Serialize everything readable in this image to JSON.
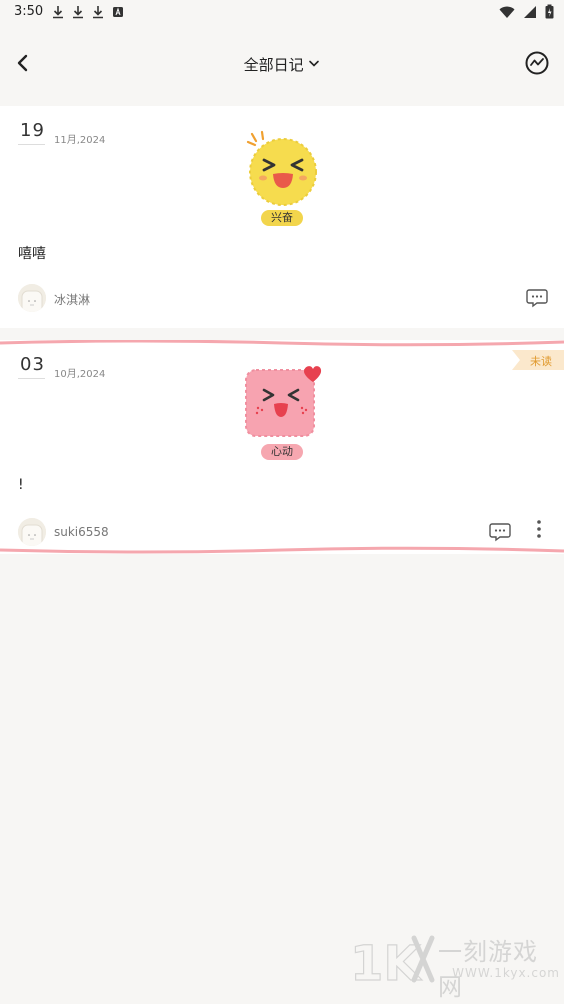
{
  "status_bar": {
    "time": "3:50"
  },
  "header": {
    "title": "全部日记"
  },
  "entries": [
    {
      "day": "19",
      "month_year": "11月,2024",
      "mood_label": "兴奋",
      "content": "嘻嘻",
      "author": "冰淇淋"
    },
    {
      "day": "03",
      "month_year": "10月,2024",
      "mood_label": "心动",
      "content": "!",
      "author": "suki6558",
      "badge": "未读"
    }
  ],
  "watermark": {
    "brand": "一刻游戏网",
    "url": "WWW.1kyx.com"
  },
  "colors": {
    "yellow": "#f2d54c",
    "pink": "#f6a7b0",
    "unread": "#e09a2f",
    "unread_bg": "#fbe8cc"
  }
}
